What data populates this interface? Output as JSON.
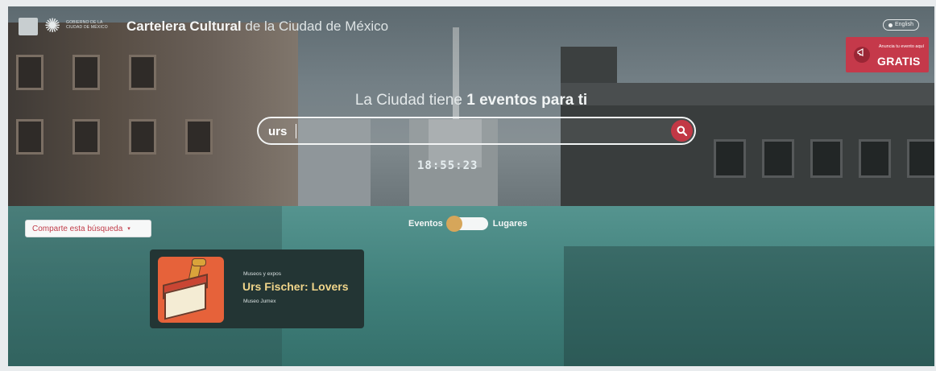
{
  "header": {
    "gov_text": "GOBIERNO DE LA CIUDAD DE MÉXICO",
    "title_bold": "Cartelera Cultural",
    "title_light": " de la Ciudad de México",
    "language_label": "English"
  },
  "promo": {
    "small_text": "Anuncia tu evento aquí",
    "big_text": "GRATIS"
  },
  "hero": {
    "headline_lead": "La Ciudad tiene ",
    "headline_bold": "1 eventos para ti",
    "clock_text": "18:55:23"
  },
  "search": {
    "value": "urs",
    "placeholder": ""
  },
  "share": {
    "label": "Comparte esta búsqueda"
  },
  "toggle": {
    "left_label": "Eventos",
    "right_label": "Lugares"
  },
  "results": [
    {
      "category": "Museos y expos",
      "title": "Urs Fischer: Lovers",
      "venue": "Museo Jumex"
    }
  ],
  "colors": {
    "accent_red": "#c5394a",
    "teal": "#4a8a85",
    "card_title": "#f0d58a"
  },
  "icons": {
    "search_button": "search-icon",
    "promo": "megaphone-icon",
    "language": "globe-dot-icon",
    "share_dropdown": "chevron-down-icon"
  }
}
